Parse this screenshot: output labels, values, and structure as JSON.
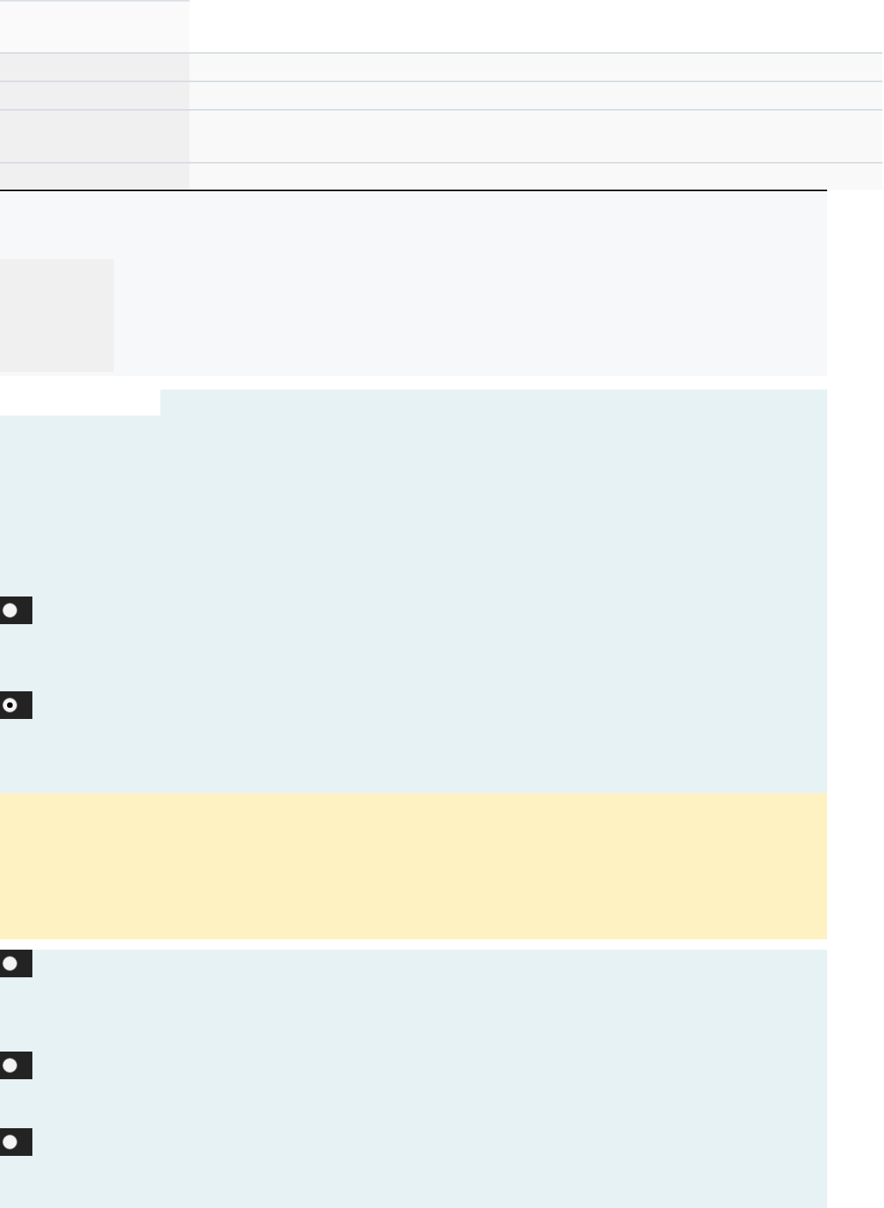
{
  "choice_groups": [
    {
      "options": [
        {
          "selected": false
        },
        {
          "selected": true
        }
      ]
    },
    {
      "options": [
        {
          "selected": false
        },
        {
          "selected": false
        },
        {
          "selected": false
        }
      ]
    }
  ]
}
